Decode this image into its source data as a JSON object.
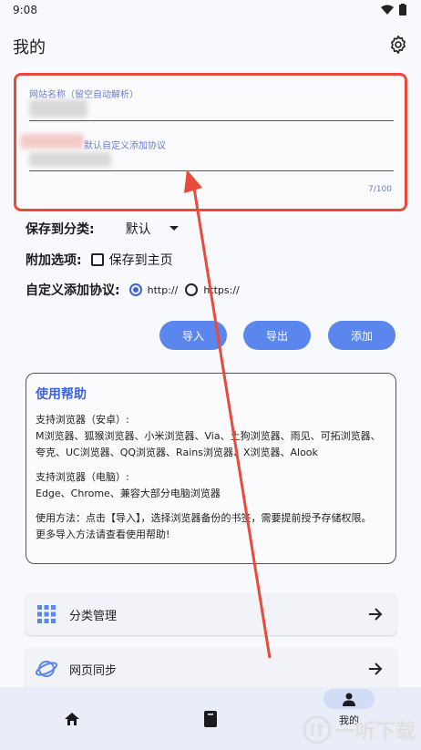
{
  "status_bar": {
    "time": "9:08"
  },
  "header": {
    "title": "我的"
  },
  "form": {
    "url_label": "网站名称（留空自动解析）",
    "protocol_label": "默认自定义添加协议",
    "char_count": "7/100"
  },
  "options": {
    "save_to_label": "保存到分类:",
    "save_to_value": "默认",
    "extra_label": "附加选项:",
    "save_home_label": "保存到主页",
    "protocol_label": "自定义添加协议:",
    "http_label": "http://",
    "https_label": "https://"
  },
  "buttons": {
    "import": "导入",
    "export": "导出",
    "add": "添加"
  },
  "help": {
    "title": "使用帮助",
    "android_title": "支持浏览器（安卓）:",
    "android_list": "M浏览器、狐猴浏览器、小米浏览器、Via、土狗浏览器、雨见、可拓浏览器、夸克、UC浏览器、QQ浏览器、Rains浏览器、X浏览器、Alook",
    "pc_title": "支持浏览器（电脑）:",
    "pc_list": "Edge、Chrome、兼容大部分电脑浏览器",
    "usage": "使用方法：点击【导入】，选择浏览器备份的书签，需要提前授予存储权限。",
    "more": "更多导入方法请查看使用帮助!"
  },
  "menu": [
    {
      "label": "分类管理",
      "icon": "grid-icon"
    },
    {
      "label": "网页同步",
      "icon": "planet-icon"
    }
  ],
  "nav": {
    "mine_label": "我的"
  },
  "watermark": {
    "text": "一听下载"
  },
  "colors": {
    "accent": "#5b86ee",
    "highlight": "#e84a3c"
  }
}
